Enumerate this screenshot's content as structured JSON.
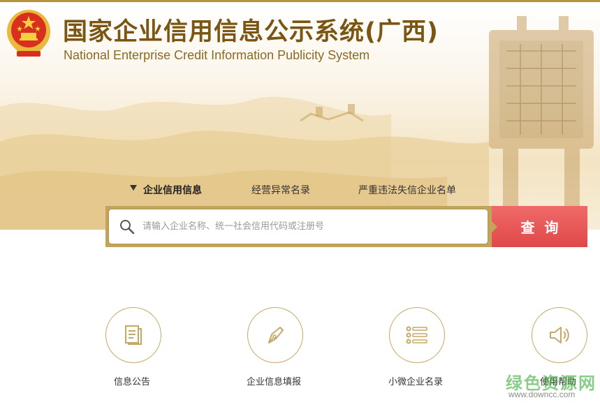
{
  "header": {
    "title_cn": "国家企业信用信息公示系统(广西)",
    "title_en": "National Enterprise Credit Information Publicity System",
    "emblem_icon": "national-emblem-icon"
  },
  "tabs": [
    {
      "label": "企业信用信息",
      "active": true
    },
    {
      "label": "经营异常名录",
      "active": false
    },
    {
      "label": "严重违法失信企业名单",
      "active": false
    }
  ],
  "search": {
    "placeholder": "请输入企业名称、统一社会信用代码或注册号",
    "value": "",
    "button_label": "查询",
    "icon": "search-icon"
  },
  "features": [
    {
      "label": "信息公告",
      "icon": "document-icon"
    },
    {
      "label": "企业信息填报",
      "icon": "pen-icon"
    },
    {
      "label": "小微企业名录",
      "icon": "list-icon"
    },
    {
      "label": "使用帮助",
      "icon": "speaker-icon"
    }
  ],
  "watermark": {
    "cn": "绿色资源网",
    "en": "www.downcc.com"
  },
  "colors": {
    "gold": "#b8923a",
    "title": "#7a5612",
    "search_button": "#e04848"
  }
}
